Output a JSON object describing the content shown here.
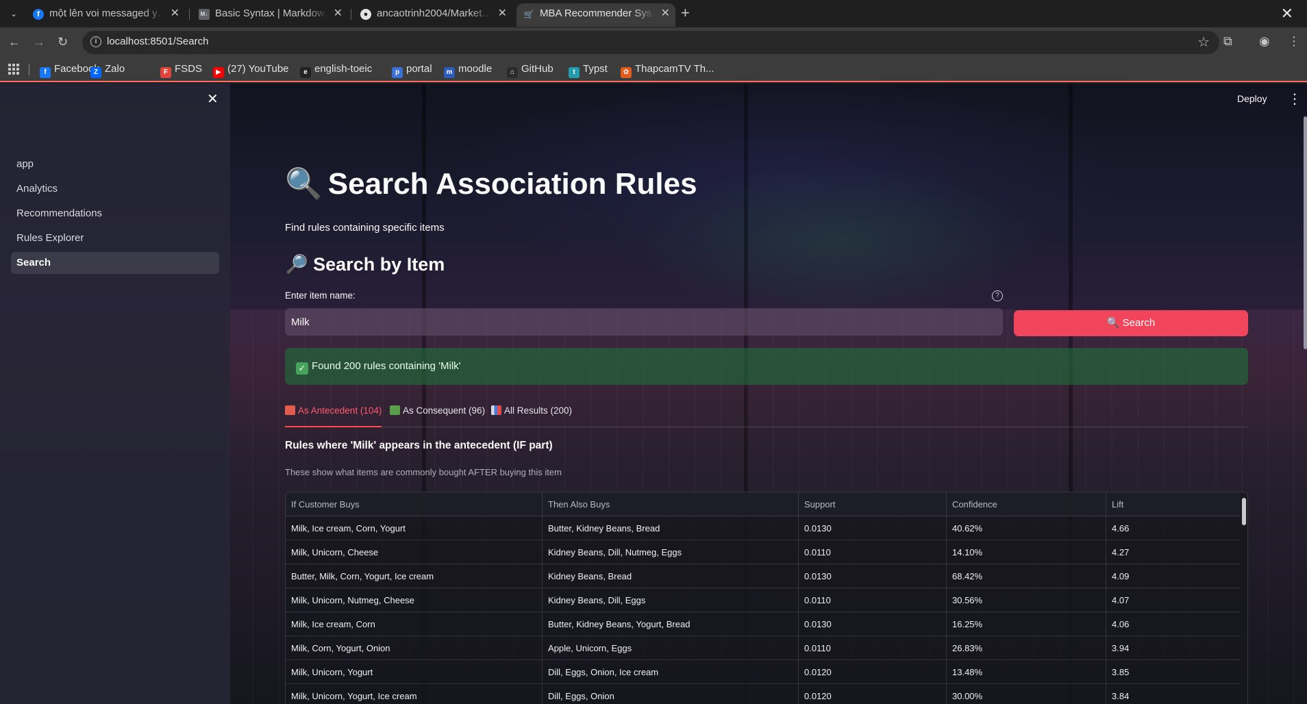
{
  "browser": {
    "tabs": [
      {
        "title": "một lên voi messaged y…",
        "icon": "facebook-icon"
      },
      {
        "title": "Basic Syntax | Markdow…",
        "icon": "markdown-icon"
      },
      {
        "title": "ancaotrinh2004/Market…",
        "icon": "github-icon"
      },
      {
        "title": "MBA Recommender Sys…",
        "icon": "cart-icon",
        "active": true
      }
    ],
    "url": "localhost:8501/Search",
    "bookmarks": [
      {
        "label": "Facebook",
        "icon": "facebook-icon",
        "color": "#1877f2",
        "glyph": "f"
      },
      {
        "label": "Zalo",
        "icon": "zalo-icon",
        "color": "#0068ff",
        "glyph": "Z"
      },
      {
        "label": "FSDS",
        "icon": "fsds-icon",
        "color": "#e0443b",
        "glyph": "F"
      },
      {
        "label": "(27) YouTube",
        "icon": "youtube-icon",
        "color": "#ff0000",
        "glyph": "▶"
      },
      {
        "label": "english-toeic",
        "icon": "toeic-icon",
        "color": "#222222",
        "glyph": "e"
      },
      {
        "label": "portal",
        "icon": "portal-icon",
        "color": "#3b6fd6",
        "glyph": "p"
      },
      {
        "label": "moodle",
        "icon": "moodle-icon",
        "color": "#2c5bb8",
        "glyph": "m"
      },
      {
        "label": "GitHub",
        "icon": "github-icon",
        "color": "#2b2b2b",
        "glyph": "⌂"
      },
      {
        "label": "Typst",
        "icon": "typst-icon",
        "color": "#239dad",
        "glyph": "t"
      },
      {
        "label": "ThapcamTV Th...",
        "icon": "thapcam-icon",
        "color": "#e25a1c",
        "glyph": "✿"
      }
    ]
  },
  "sidebar": {
    "items": [
      {
        "label": "app"
      },
      {
        "label": "Analytics"
      },
      {
        "label": "Recommendations"
      },
      {
        "label": "Rules Explorer"
      },
      {
        "label": "Search",
        "active": true
      }
    ]
  },
  "header": {
    "deploy_label": "Deploy"
  },
  "main": {
    "title_icon": "🔍",
    "title": "Search Association Rules",
    "subtitle": "Find rules containing specific items",
    "section_icon": "🔎",
    "section_title": "Search by Item",
    "input_label": "Enter item name:",
    "input_value": "Milk",
    "search_button": "🔍 Search",
    "success_message": "Found 200 rules containing 'Milk'",
    "tabs": [
      {
        "label": "As Antecedent (104)",
        "icon": "outbox-icon",
        "active": true
      },
      {
        "label": "As Consequent (96)",
        "icon": "inbox-icon"
      },
      {
        "label": "All Results (200)",
        "icon": "bar-chart-icon"
      }
    ],
    "section_heading": "Rules where 'Milk' appears in the antecedent (IF part)",
    "section_caption": "These show what items are commonly bought AFTER buying this item",
    "table": {
      "columns": [
        "If Customer Buys",
        "Then Also Buys",
        "Support",
        "Confidence",
        "Lift"
      ],
      "rows": [
        [
          "Milk, Ice cream, Corn, Yogurt",
          "Butter, Kidney Beans, Bread",
          "0.0130",
          "40.62%",
          "4.66"
        ],
        [
          "Milk, Unicorn, Cheese",
          "Kidney Beans, Dill, Nutmeg, Eggs",
          "0.0110",
          "14.10%",
          "4.27"
        ],
        [
          "Butter, Milk, Corn, Yogurt, Ice cream",
          "Kidney Beans, Bread",
          "0.0130",
          "68.42%",
          "4.09"
        ],
        [
          "Milk, Unicorn, Nutmeg, Cheese",
          "Kidney Beans, Dill, Eggs",
          "0.0110",
          "30.56%",
          "4.07"
        ],
        [
          "Milk, Ice cream, Corn",
          "Butter, Kidney Beans, Yogurt, Bread",
          "0.0130",
          "16.25%",
          "4.06"
        ],
        [
          "Milk, Corn, Yogurt, Onion",
          "Apple, Unicorn, Eggs",
          "0.0110",
          "26.83%",
          "3.94"
        ],
        [
          "Milk, Unicorn, Yogurt",
          "Dill, Eggs, Onion, Ice cream",
          "0.0120",
          "13.48%",
          "3.85"
        ],
        [
          "Milk, Unicorn, Yogurt, Ice cream",
          "Dill, Eggs, Onion",
          "0.0120",
          "30.00%",
          "3.84"
        ]
      ]
    }
  },
  "colors": {
    "accent": "#ff4b4b",
    "button": "#f0455a",
    "success_bg": "#216e3c"
  }
}
